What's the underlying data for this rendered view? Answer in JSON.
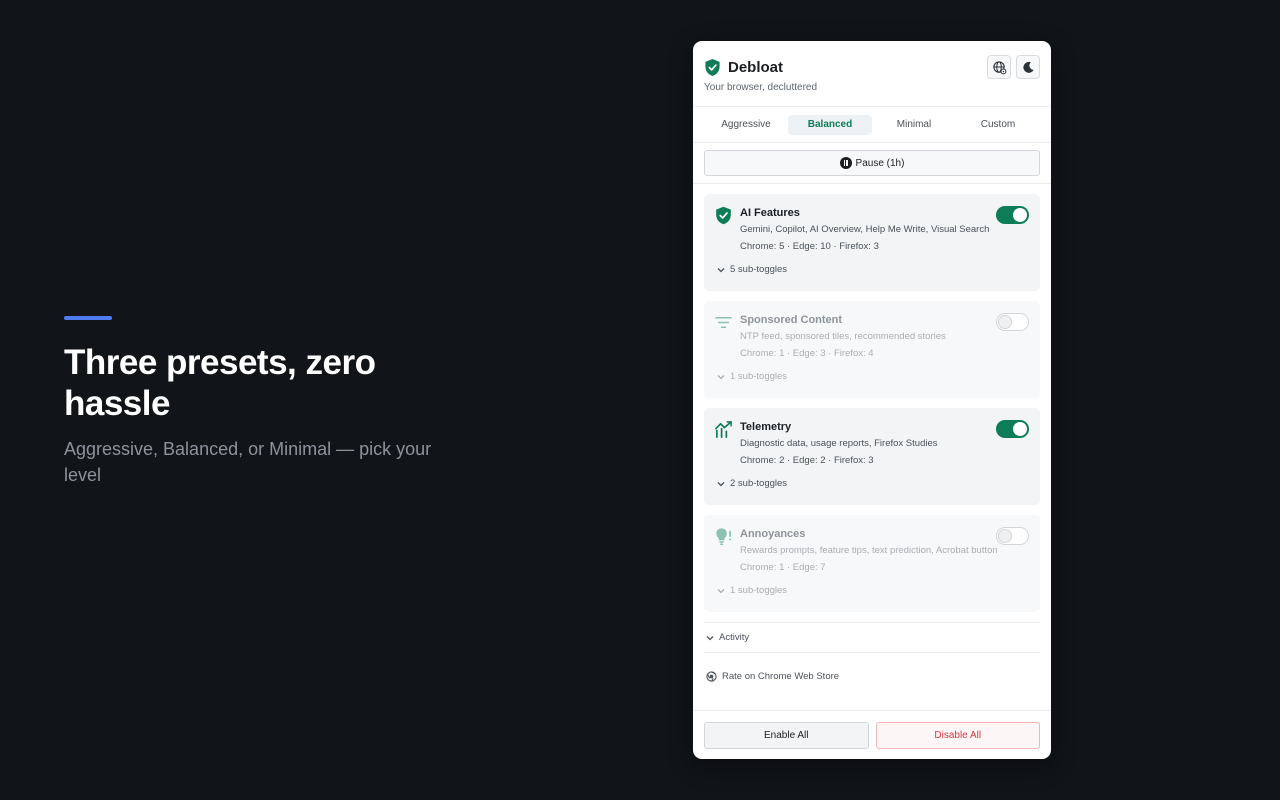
{
  "hero": {
    "title": "Three presets, zero hassle",
    "subtitle": "Aggressive, Balanced, or Minimal — pick your level"
  },
  "popup": {
    "app_name": "Debloat",
    "tagline": "Your browser, decluttered",
    "header_buttons": [
      {
        "icon": "globe-settings-icon"
      },
      {
        "icon": "moon-icon"
      }
    ],
    "tabs": [
      {
        "label": "Aggressive",
        "active": false
      },
      {
        "label": "Balanced",
        "active": true
      },
      {
        "label": "Minimal",
        "active": false
      },
      {
        "label": "Custom",
        "active": false
      }
    ],
    "pause_label": "Pause (1h)",
    "categories": [
      {
        "title": "AI Features",
        "description": "Gemini, Copilot, AI Overview, Help Me Write, Visual Search",
        "counts": "Chrome: 5 · Edge: 10 · Firefox: 3",
        "subtoggles": "5 sub-toggles",
        "enabled": true,
        "icon": "shield-check-icon"
      },
      {
        "title": "Sponsored Content",
        "description": "NTP feed, sponsored tiles, recommended stories",
        "counts": "Chrome: 1 · Edge: 3 · Firefox: 4",
        "subtoggles": "1 sub-toggles",
        "enabled": false,
        "icon": "filter-icon"
      },
      {
        "title": "Telemetry",
        "description": "Diagnostic data, usage reports, Firefox Studies",
        "counts": "Chrome: 2 · Edge: 2 · Firefox: 3",
        "subtoggles": "2 sub-toggles",
        "enabled": true,
        "icon": "chart-icon"
      },
      {
        "title": "Annoyances",
        "description": "Rewards prompts, feature tips, text prediction, Acrobat button",
        "counts": "Chrome: 1 · Edge: 7",
        "subtoggles": "1 sub-toggles",
        "enabled": false,
        "icon": "lightbulb-icon"
      }
    ],
    "activity_label": "Activity",
    "rate_label": "Rate on Chrome Web Store",
    "enable_all_label": "Enable All",
    "disable_all_label": "Disable All"
  },
  "colors": {
    "accent": "#0d7d57",
    "danger": "#d63b40",
    "hero_bar": "#4f7bf0",
    "page_bg": "#111418"
  }
}
